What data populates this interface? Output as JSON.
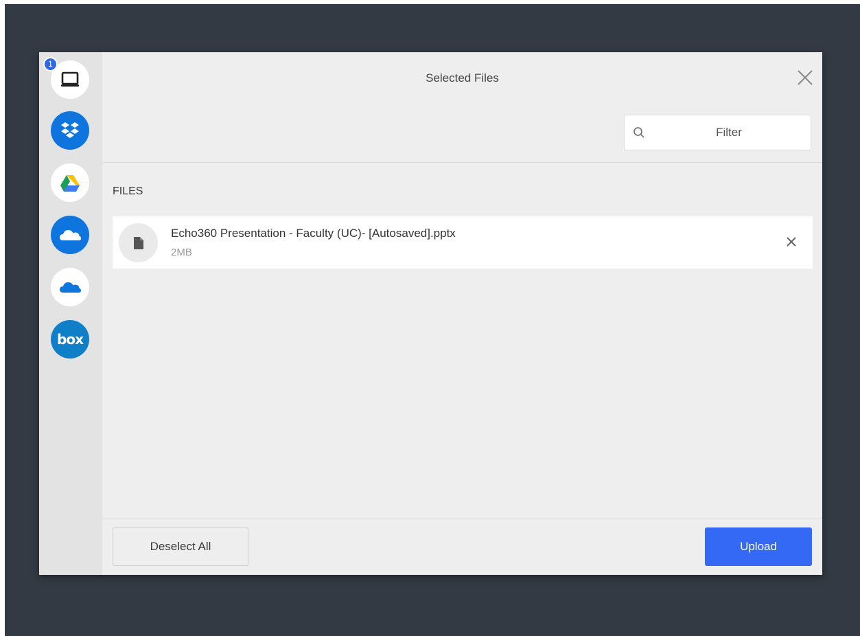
{
  "sources": {
    "local_badge_count": "1",
    "items": [
      {
        "name": "My Device",
        "icon": "laptop-icon"
      },
      {
        "name": "Dropbox",
        "icon": "dropbox-icon"
      },
      {
        "name": "Google Drive",
        "icon": "google-drive-icon"
      },
      {
        "name": "OneDrive for Business",
        "icon": "onedrive-business-icon"
      },
      {
        "name": "OneDrive",
        "icon": "onedrive-icon"
      },
      {
        "name": "Box",
        "icon": "box-icon",
        "logo_text": "box"
      }
    ]
  },
  "header": {
    "title": "Selected Files",
    "close_icon": "close-icon"
  },
  "filter": {
    "placeholder": "Filter",
    "icon": "search-icon"
  },
  "files_section": {
    "label": "FILES",
    "files": [
      {
        "name": "Echo360 Presentation - Faculty (UC)- [Autosaved].pptx",
        "size": "2MB",
        "icon": "file-icon",
        "remove_icon": "remove-icon"
      }
    ]
  },
  "footer": {
    "deselect_label": "Deselect All",
    "upload_label": "Upload"
  },
  "colors": {
    "backdrop": "#343a44",
    "panel": "#eeeeee",
    "sidebar": "#e3e3e3",
    "accent_blue": "#3469f5",
    "dropbox_blue": "#0f75de",
    "box_blue": "#0f80c8"
  }
}
